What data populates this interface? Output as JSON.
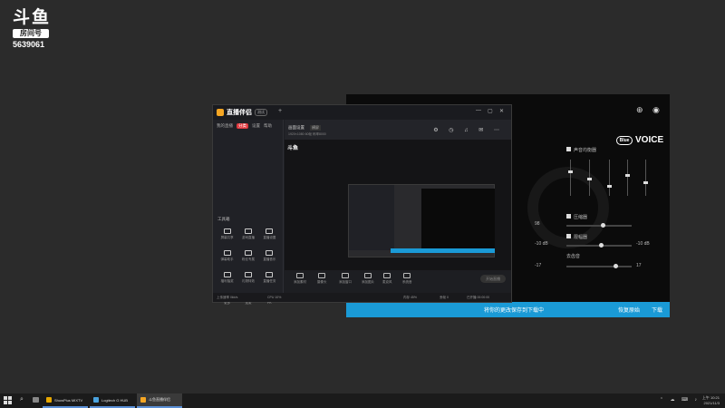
{
  "overlay": {
    "logo_text": "斗鱼",
    "logo_tag": "房间号",
    "room_number": "5639061"
  },
  "blue_voice": {
    "brand": "VOICE",
    "brand_ring": "Blue",
    "icons": [
      "target-icon",
      "user-icon"
    ],
    "labels": {
      "eq": "声音均衡器",
      "compressor": "压缩器",
      "limiter": "限幅器",
      "deesser": "去齿音",
      "dB1": "-10 dB",
      "dB2": "-10 dB",
      "dB3": "-3 dB",
      "val1": "98",
      "val2": "-17",
      "val3": "17"
    },
    "sliders": [
      0.55,
      0.5,
      0.7,
      0.65
    ],
    "vsliders": [
      0.3,
      0.5,
      0.7,
      0.4,
      0.6,
      0.5
    ],
    "bottom_bar": {
      "text": "将你的更改保存到下载中",
      "undo": "恢复原始",
      "next": "下载"
    }
  },
  "app": {
    "name": "直播伴侣",
    "badge": "测试",
    "add": "+",
    "window_controls": [
      "—",
      "▢",
      "✕"
    ],
    "tabs": [
      "我的直播",
      "分类",
      "设置",
      "帮助"
    ],
    "active_tab": 1,
    "tool_section": "工具箱",
    "tools": [
      "屏幕共享",
      "游戏直播",
      "直播设置",
      "弹幕助手",
      "粉丝专属",
      "直播音乐",
      "福利抽奖",
      "礼物特效",
      "直播任务",
      "更多",
      "连麦",
      "PK"
    ],
    "preview": {
      "title": "画面设置",
      "chip": "横屏",
      "sub": "1920×1080  60帧  码率8000",
      "icons": "⚙ ◷ ♫ ✉ ⋯",
      "mini_logo": "斗鱼"
    },
    "toolbar": [
      "添加素材",
      "摄像头",
      "添加窗口",
      "添加图片",
      "麦克风",
      "系统音"
    ],
    "start_label": "开始直播",
    "status": [
      "上传速率 0kb/s",
      "CPU 10%",
      "内存 45%",
      "丢帧 0",
      "已开播 00:00:00"
    ]
  },
  "taskbar": {
    "items": [
      {
        "label": "ShowPlus MIXTV",
        "color": "#e8a800",
        "active": false
      },
      {
        "label": "Logitech G HUB",
        "color": "#4aa3df",
        "active": false
      },
      {
        "label": "斗鱼直播伴侣",
        "color": "#f5a623",
        "active": true
      }
    ],
    "tray": "⌃ ☁ ⌨ ♪",
    "time": "上午 10:21",
    "date": "2021/11/3"
  }
}
